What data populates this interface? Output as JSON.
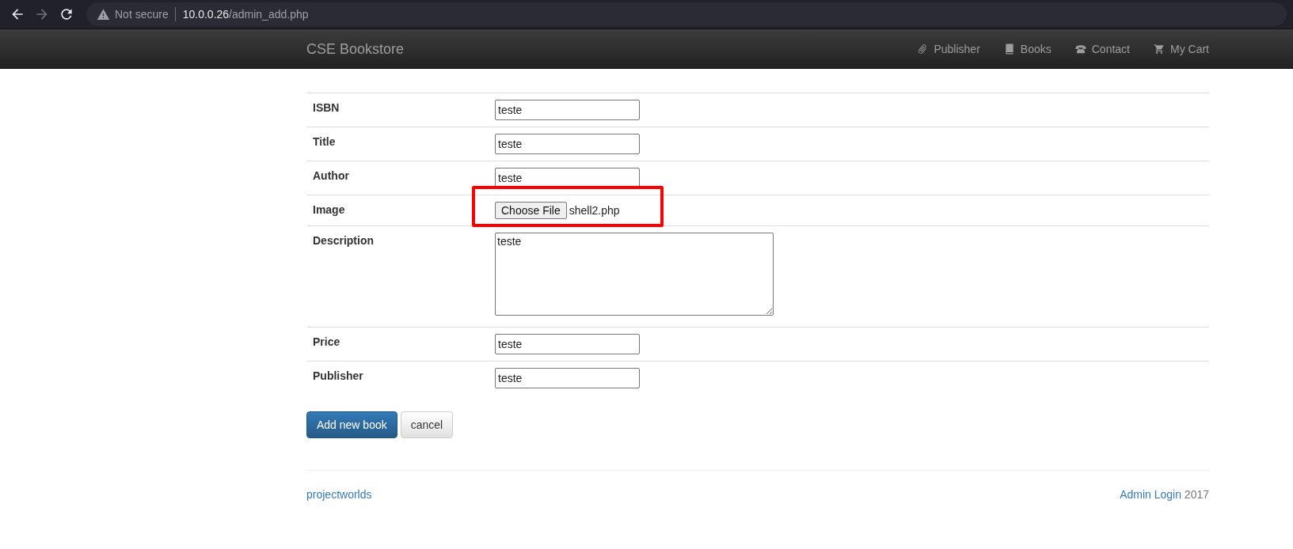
{
  "browser": {
    "nav_buttons": [
      {
        "kind": "back",
        "disabled": false
      },
      {
        "kind": "forward",
        "disabled": true
      },
      {
        "kind": "reload",
        "disabled": false
      }
    ],
    "security_label": "Not secure",
    "url_host": "10.0.0.26",
    "url_path": "/admin_add.php"
  },
  "navbar": {
    "brand": "CSE Bookstore",
    "links": [
      {
        "kind": "paperclip",
        "label": "Publisher"
      },
      {
        "kind": "book",
        "label": "Books"
      },
      {
        "kind": "phone",
        "label": "Contact"
      },
      {
        "kind": "cart",
        "label": "My Cart"
      }
    ]
  },
  "form": {
    "rows": [
      {
        "label": "ISBN",
        "kind": "text",
        "value": "teste",
        "highlighted": false
      },
      {
        "label": "Title",
        "kind": "text",
        "value": "teste",
        "highlighted": false
      },
      {
        "label": "Author",
        "kind": "text",
        "value": "teste",
        "highlighted": false
      },
      {
        "label": "Image",
        "kind": "file",
        "button": "Choose File",
        "value": "shell2.php",
        "highlighted": true
      },
      {
        "label": "Description",
        "kind": "textarea",
        "value": "teste",
        "highlighted": false
      },
      {
        "label": "Price",
        "kind": "text",
        "value": "teste",
        "highlighted": false
      },
      {
        "label": "Publisher",
        "kind": "text",
        "value": "teste",
        "highlighted": false
      }
    ],
    "buttons": [
      {
        "label": "Add new book",
        "kind": "primary"
      },
      {
        "label": "cancel",
        "kind": "default"
      }
    ]
  },
  "footer": {
    "left_link": "projectworlds",
    "right_link": "Admin Login",
    "year": "2017"
  }
}
